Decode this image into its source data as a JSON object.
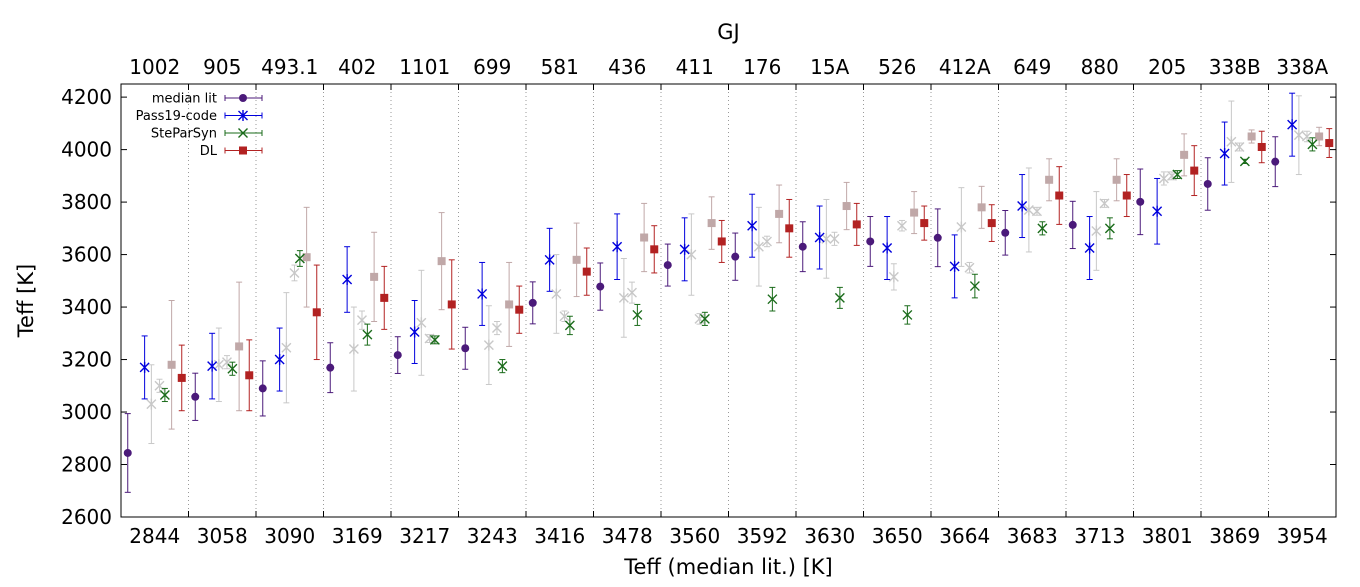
{
  "chart_data": {
    "type": "scatter",
    "title": "",
    "xlabel": "Teff (median lit.) [K]",
    "ylabel": "Teff [K]",
    "x2label": "GJ",
    "ylim": [
      2600,
      4250
    ],
    "yticks": [
      2600,
      2800,
      3000,
      3200,
      3400,
      3600,
      3800,
      4000,
      4200
    ],
    "grid": "vertical dotted separators between stars",
    "legend_position": "top-left",
    "categories": [
      "2844",
      "3058",
      "3090",
      "3169",
      "3217",
      "3243",
      "3416",
      "3478",
      "3560",
      "3592",
      "3630",
      "3650",
      "3664",
      "3683",
      "3713",
      "3801",
      "3869",
      "3954"
    ],
    "top_categories": [
      "1002",
      "905",
      "493.1",
      "402",
      "1101",
      "699",
      "581",
      "436",
      "411",
      "176",
      "15A",
      "526",
      "412A",
      "649",
      "880",
      "205",
      "338B",
      "338A"
    ],
    "series": [
      {
        "name": "median lit",
        "marker": "circle",
        "color": "#4b1a7a",
        "values": [
          2844,
          3058,
          3090,
          3169,
          3217,
          3243,
          3416,
          3478,
          3560,
          3592,
          3630,
          3650,
          3664,
          3683,
          3713,
          3801,
          3869,
          3954
        ],
        "errors": [
          150,
          90,
          105,
          95,
          70,
          80,
          80,
          90,
          80,
          90,
          95,
          95,
          110,
          85,
          90,
          125,
          100,
          95
        ]
      },
      {
        "name": "Pass19-code",
        "marker": "asterisk",
        "color": "#0000dd",
        "values": [
          3170,
          3175,
          3200,
          3505,
          3305,
          3450,
          3580,
          3630,
          3620,
          3710,
          3665,
          3625,
          3555,
          3785,
          3625,
          3765,
          3985,
          4095
        ],
        "errors": [
          120,
          125,
          120,
          125,
          120,
          120,
          120,
          125,
          120,
          120,
          120,
          120,
          120,
          120,
          120,
          125,
          120,
          120
        ]
      },
      {
        "name": "SteParSyn",
        "marker": "x",
        "color": "#1a6b1a",
        "values": [
          3065,
          3165,
          3585,
          3295,
          3275,
          3175,
          3330,
          3370,
          3355,
          3430,
          3435,
          3370,
          3480,
          3700,
          3700,
          3905,
          3955,
          4020
        ],
        "errors": [
          25,
          25,
          30,
          40,
          15,
          25,
          35,
          40,
          25,
          45,
          40,
          35,
          45,
          25,
          40,
          15,
          8,
          25
        ]
      },
      {
        "name": "DL",
        "marker": "square",
        "color": "#b22222",
        "values": [
          3130,
          3140,
          3380,
          3435,
          3410,
          3390,
          3535,
          3620,
          3650,
          3700,
          3715,
          3720,
          3720,
          3825,
          3825,
          3920,
          4010,
          4025
        ],
        "errors": [
          125,
          135,
          180,
          120,
          170,
          90,
          90,
          90,
          80,
          110,
          80,
          65,
          70,
          110,
          80,
          95,
          60,
          55
        ]
      }
    ],
    "previous_versions": [
      {
        "of": "Pass19-code",
        "marker": "asterisk",
        "color": "#c8c8c8",
        "values": [
          3030,
          3180,
          3245,
          3240,
          3340,
          3255,
          3450,
          3435,
          3600,
          3630,
          3660,
          3515,
          3705,
          3770,
          3690,
          3890,
          4030,
          4055
        ],
        "errors": [
          150,
          140,
          210,
          160,
          200,
          150,
          150,
          150,
          155,
          150,
          150,
          50,
          150,
          160,
          150,
          25,
          155,
          150
        ]
      },
      {
        "of": "SteParSyn",
        "marker": "x",
        "color": "#c8c8c8",
        "values": [
          3100,
          3190,
          3530,
          3350,
          3280,
          3320,
          3365,
          3455,
          3355,
          3650,
          3660,
          3710,
          3550,
          3765,
          3795,
          3900,
          4010,
          4050
        ],
        "errors": [
          25,
          25,
          30,
          35,
          15,
          25,
          20,
          40,
          20,
          20,
          25,
          20,
          20,
          15,
          15,
          15,
          15,
          20
        ]
      },
      {
        "of": "DL",
        "marker": "square",
        "color": "#c0a8a8",
        "values": [
          3180,
          3250,
          3590,
          3515,
          3575,
          3410,
          3580,
          3665,
          3720,
          3755,
          3785,
          3760,
          3780,
          3885,
          3885,
          3980,
          4050,
          4050
        ],
        "errors": [
          245,
          245,
          190,
          170,
          185,
          160,
          140,
          130,
          100,
          110,
          90,
          80,
          80,
          80,
          80,
          80,
          25,
          35
        ]
      }
    ]
  }
}
